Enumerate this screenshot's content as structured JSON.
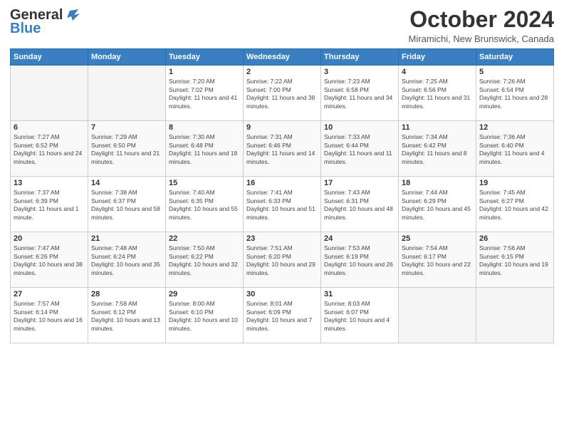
{
  "header": {
    "logo_line1": "General",
    "logo_line2": "Blue",
    "month": "October 2024",
    "location": "Miramichi, New Brunswick, Canada"
  },
  "weekdays": [
    "Sunday",
    "Monday",
    "Tuesday",
    "Wednesday",
    "Thursday",
    "Friday",
    "Saturday"
  ],
  "weeks": [
    [
      {
        "day": "",
        "empty": true
      },
      {
        "day": "",
        "empty": true
      },
      {
        "day": "1",
        "sunrise": "Sunrise: 7:20 AM",
        "sunset": "Sunset: 7:02 PM",
        "daylight": "Daylight: 11 hours and 41 minutes."
      },
      {
        "day": "2",
        "sunrise": "Sunrise: 7:22 AM",
        "sunset": "Sunset: 7:00 PM",
        "daylight": "Daylight: 11 hours and 38 minutes."
      },
      {
        "day": "3",
        "sunrise": "Sunrise: 7:23 AM",
        "sunset": "Sunset: 6:58 PM",
        "daylight": "Daylight: 11 hours and 34 minutes."
      },
      {
        "day": "4",
        "sunrise": "Sunrise: 7:25 AM",
        "sunset": "Sunset: 6:56 PM",
        "daylight": "Daylight: 11 hours and 31 minutes."
      },
      {
        "day": "5",
        "sunrise": "Sunrise: 7:26 AM",
        "sunset": "Sunset: 6:54 PM",
        "daylight": "Daylight: 11 hours and 28 minutes."
      }
    ],
    [
      {
        "day": "6",
        "sunrise": "Sunrise: 7:27 AM",
        "sunset": "Sunset: 6:52 PM",
        "daylight": "Daylight: 11 hours and 24 minutes."
      },
      {
        "day": "7",
        "sunrise": "Sunrise: 7:29 AM",
        "sunset": "Sunset: 6:50 PM",
        "daylight": "Daylight: 11 hours and 21 minutes."
      },
      {
        "day": "8",
        "sunrise": "Sunrise: 7:30 AM",
        "sunset": "Sunset: 6:48 PM",
        "daylight": "Daylight: 11 hours and 18 minutes."
      },
      {
        "day": "9",
        "sunrise": "Sunrise: 7:31 AM",
        "sunset": "Sunset: 6:46 PM",
        "daylight": "Daylight: 11 hours and 14 minutes."
      },
      {
        "day": "10",
        "sunrise": "Sunrise: 7:33 AM",
        "sunset": "Sunset: 6:44 PM",
        "daylight": "Daylight: 11 hours and 11 minutes."
      },
      {
        "day": "11",
        "sunrise": "Sunrise: 7:34 AM",
        "sunset": "Sunset: 6:42 PM",
        "daylight": "Daylight: 11 hours and 8 minutes."
      },
      {
        "day": "12",
        "sunrise": "Sunrise: 7:36 AM",
        "sunset": "Sunset: 6:40 PM",
        "daylight": "Daylight: 11 hours and 4 minutes."
      }
    ],
    [
      {
        "day": "13",
        "sunrise": "Sunrise: 7:37 AM",
        "sunset": "Sunset: 6:39 PM",
        "daylight": "Daylight: 11 hours and 1 minute."
      },
      {
        "day": "14",
        "sunrise": "Sunrise: 7:38 AM",
        "sunset": "Sunset: 6:37 PM",
        "daylight": "Daylight: 10 hours and 58 minutes."
      },
      {
        "day": "15",
        "sunrise": "Sunrise: 7:40 AM",
        "sunset": "Sunset: 6:35 PM",
        "daylight": "Daylight: 10 hours and 55 minutes."
      },
      {
        "day": "16",
        "sunrise": "Sunrise: 7:41 AM",
        "sunset": "Sunset: 6:33 PM",
        "daylight": "Daylight: 10 hours and 51 minutes."
      },
      {
        "day": "17",
        "sunrise": "Sunrise: 7:43 AM",
        "sunset": "Sunset: 6:31 PM",
        "daylight": "Daylight: 10 hours and 48 minutes."
      },
      {
        "day": "18",
        "sunrise": "Sunrise: 7:44 AM",
        "sunset": "Sunset: 6:29 PM",
        "daylight": "Daylight: 10 hours and 45 minutes."
      },
      {
        "day": "19",
        "sunrise": "Sunrise: 7:45 AM",
        "sunset": "Sunset: 6:27 PM",
        "daylight": "Daylight: 10 hours and 42 minutes."
      }
    ],
    [
      {
        "day": "20",
        "sunrise": "Sunrise: 7:47 AM",
        "sunset": "Sunset: 6:26 PM",
        "daylight": "Daylight: 10 hours and 38 minutes."
      },
      {
        "day": "21",
        "sunrise": "Sunrise: 7:48 AM",
        "sunset": "Sunset: 6:24 PM",
        "daylight": "Daylight: 10 hours and 35 minutes."
      },
      {
        "day": "22",
        "sunrise": "Sunrise: 7:50 AM",
        "sunset": "Sunset: 6:22 PM",
        "daylight": "Daylight: 10 hours and 32 minutes."
      },
      {
        "day": "23",
        "sunrise": "Sunrise: 7:51 AM",
        "sunset": "Sunset: 6:20 PM",
        "daylight": "Daylight: 10 hours and 29 minutes."
      },
      {
        "day": "24",
        "sunrise": "Sunrise: 7:53 AM",
        "sunset": "Sunset: 6:19 PM",
        "daylight": "Daylight: 10 hours and 26 minutes."
      },
      {
        "day": "25",
        "sunrise": "Sunrise: 7:54 AM",
        "sunset": "Sunset: 6:17 PM",
        "daylight": "Daylight: 10 hours and 22 minutes."
      },
      {
        "day": "26",
        "sunrise": "Sunrise: 7:56 AM",
        "sunset": "Sunset: 6:15 PM",
        "daylight": "Daylight: 10 hours and 19 minutes."
      }
    ],
    [
      {
        "day": "27",
        "sunrise": "Sunrise: 7:57 AM",
        "sunset": "Sunset: 6:14 PM",
        "daylight": "Daylight: 10 hours and 16 minutes."
      },
      {
        "day": "28",
        "sunrise": "Sunrise: 7:58 AM",
        "sunset": "Sunset: 6:12 PM",
        "daylight": "Daylight: 10 hours and 13 minutes."
      },
      {
        "day": "29",
        "sunrise": "Sunrise: 8:00 AM",
        "sunset": "Sunset: 6:10 PM",
        "daylight": "Daylight: 10 hours and 10 minutes."
      },
      {
        "day": "30",
        "sunrise": "Sunrise: 8:01 AM",
        "sunset": "Sunset: 6:09 PM",
        "daylight": "Daylight: 10 hours and 7 minutes."
      },
      {
        "day": "31",
        "sunrise": "Sunrise: 8:03 AM",
        "sunset": "Sunset: 6:07 PM",
        "daylight": "Daylight: 10 hours and 4 minutes."
      },
      {
        "day": "",
        "empty": true
      },
      {
        "day": "",
        "empty": true
      }
    ]
  ]
}
